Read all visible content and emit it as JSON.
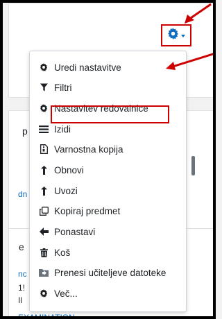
{
  "menu": {
    "items": [
      {
        "label": "Uredi nastavitve",
        "icon": "gear-icon"
      },
      {
        "label": "Filtri",
        "icon": "filter-icon"
      },
      {
        "label": "Nastavitev redovalnice",
        "icon": "gear-icon"
      },
      {
        "label": "Izidi",
        "icon": "list-icon"
      },
      {
        "label": "Varnostna kopija",
        "icon": "file-archive-icon"
      },
      {
        "label": "Obnovi",
        "icon": "level-up-icon"
      },
      {
        "label": "Uvozi",
        "icon": "level-up-icon"
      },
      {
        "label": "Kopiraj predmet",
        "icon": "copy-icon"
      },
      {
        "label": "Ponastavi",
        "icon": "arrow-left-icon"
      },
      {
        "label": "Koš",
        "icon": "trash-icon"
      },
      {
        "label": "Prenesi učiteljeve datoteke",
        "icon": "folder-download-icon"
      },
      {
        "label": "Več...",
        "icon": "gear-icon"
      }
    ]
  },
  "background": {
    "frag_p": "p",
    "frag_dn": "dn",
    "frag_e": "e",
    "frag_nc": "nc",
    "frag_1": "1!",
    "frag_ll": "Il",
    "frag_exam": "EXAMINATION"
  },
  "colors": {
    "accent": "#0f6cbf",
    "annotation": "#cc0000"
  }
}
